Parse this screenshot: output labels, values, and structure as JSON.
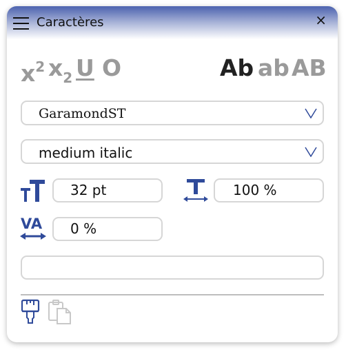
{
  "window": {
    "title": "Caractères",
    "menu_icon": "hamburger-icon",
    "close_label": "×"
  },
  "format_buttons": {
    "superscript": {
      "base": "x",
      "mark": "2"
    },
    "subscript": {
      "base": "x",
      "mark": "2"
    },
    "underline": "U",
    "outline": "O",
    "title_case": "Ab",
    "lower_case": "ab",
    "upper_case": "AB"
  },
  "font_family": {
    "value": "GaramondST"
  },
  "font_style": {
    "value": "medium italic"
  },
  "font_size": {
    "value": "32 pt"
  },
  "horizontal_scale": {
    "value": "100 %"
  },
  "tracking": {
    "value": "0 %"
  },
  "extra_field": {
    "value": ""
  },
  "bottom_tools": [
    "paint-brush-icon",
    "paste-icon"
  ],
  "colors": {
    "accent": "#2f4a9a",
    "titlebar": "#5b6fb5",
    "inactive": "#9a9a9a",
    "active_text": "#222222"
  }
}
